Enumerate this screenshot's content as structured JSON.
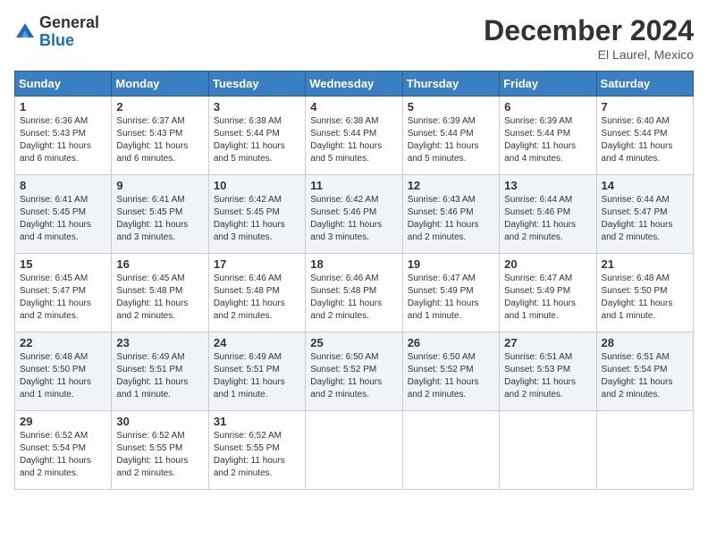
{
  "logo": {
    "general": "General",
    "blue": "Blue"
  },
  "title": "December 2024",
  "subtitle": "El Laurel, Mexico",
  "weekdays": [
    "Sunday",
    "Monday",
    "Tuesday",
    "Wednesday",
    "Thursday",
    "Friday",
    "Saturday"
  ],
  "weeks": [
    [
      {
        "day": "1",
        "sunrise": "6:36 AM",
        "sunset": "5:43 PM",
        "daylight": "11 hours and 6 minutes."
      },
      {
        "day": "2",
        "sunrise": "6:37 AM",
        "sunset": "5:43 PM",
        "daylight": "11 hours and 6 minutes."
      },
      {
        "day": "3",
        "sunrise": "6:38 AM",
        "sunset": "5:44 PM",
        "daylight": "11 hours and 5 minutes."
      },
      {
        "day": "4",
        "sunrise": "6:38 AM",
        "sunset": "5:44 PM",
        "daylight": "11 hours and 5 minutes."
      },
      {
        "day": "5",
        "sunrise": "6:39 AM",
        "sunset": "5:44 PM",
        "daylight": "11 hours and 5 minutes."
      },
      {
        "day": "6",
        "sunrise": "6:39 AM",
        "sunset": "5:44 PM",
        "daylight": "11 hours and 4 minutes."
      },
      {
        "day": "7",
        "sunrise": "6:40 AM",
        "sunset": "5:44 PM",
        "daylight": "11 hours and 4 minutes."
      }
    ],
    [
      {
        "day": "8",
        "sunrise": "6:41 AM",
        "sunset": "5:45 PM",
        "daylight": "11 hours and 4 minutes."
      },
      {
        "day": "9",
        "sunrise": "6:41 AM",
        "sunset": "5:45 PM",
        "daylight": "11 hours and 3 minutes."
      },
      {
        "day": "10",
        "sunrise": "6:42 AM",
        "sunset": "5:45 PM",
        "daylight": "11 hours and 3 minutes."
      },
      {
        "day": "11",
        "sunrise": "6:42 AM",
        "sunset": "5:46 PM",
        "daylight": "11 hours and 3 minutes."
      },
      {
        "day": "12",
        "sunrise": "6:43 AM",
        "sunset": "5:46 PM",
        "daylight": "11 hours and 2 minutes."
      },
      {
        "day": "13",
        "sunrise": "6:44 AM",
        "sunset": "5:46 PM",
        "daylight": "11 hours and 2 minutes."
      },
      {
        "day": "14",
        "sunrise": "6:44 AM",
        "sunset": "5:47 PM",
        "daylight": "11 hours and 2 minutes."
      }
    ],
    [
      {
        "day": "15",
        "sunrise": "6:45 AM",
        "sunset": "5:47 PM",
        "daylight": "11 hours and 2 minutes."
      },
      {
        "day": "16",
        "sunrise": "6:45 AM",
        "sunset": "5:48 PM",
        "daylight": "11 hours and 2 minutes."
      },
      {
        "day": "17",
        "sunrise": "6:46 AM",
        "sunset": "5:48 PM",
        "daylight": "11 hours and 2 minutes."
      },
      {
        "day": "18",
        "sunrise": "6:46 AM",
        "sunset": "5:48 PM",
        "daylight": "11 hours and 2 minutes."
      },
      {
        "day": "19",
        "sunrise": "6:47 AM",
        "sunset": "5:49 PM",
        "daylight": "11 hours and 1 minute."
      },
      {
        "day": "20",
        "sunrise": "6:47 AM",
        "sunset": "5:49 PM",
        "daylight": "11 hours and 1 minute."
      },
      {
        "day": "21",
        "sunrise": "6:48 AM",
        "sunset": "5:50 PM",
        "daylight": "11 hours and 1 minute."
      }
    ],
    [
      {
        "day": "22",
        "sunrise": "6:48 AM",
        "sunset": "5:50 PM",
        "daylight": "11 hours and 1 minute."
      },
      {
        "day": "23",
        "sunrise": "6:49 AM",
        "sunset": "5:51 PM",
        "daylight": "11 hours and 1 minute."
      },
      {
        "day": "24",
        "sunrise": "6:49 AM",
        "sunset": "5:51 PM",
        "daylight": "11 hours and 1 minute."
      },
      {
        "day": "25",
        "sunrise": "6:50 AM",
        "sunset": "5:52 PM",
        "daylight": "11 hours and 2 minutes."
      },
      {
        "day": "26",
        "sunrise": "6:50 AM",
        "sunset": "5:52 PM",
        "daylight": "11 hours and 2 minutes."
      },
      {
        "day": "27",
        "sunrise": "6:51 AM",
        "sunset": "5:53 PM",
        "daylight": "11 hours and 2 minutes."
      },
      {
        "day": "28",
        "sunrise": "6:51 AM",
        "sunset": "5:54 PM",
        "daylight": "11 hours and 2 minutes."
      }
    ],
    [
      {
        "day": "29",
        "sunrise": "6:52 AM",
        "sunset": "5:54 PM",
        "daylight": "11 hours and 2 minutes."
      },
      {
        "day": "30",
        "sunrise": "6:52 AM",
        "sunset": "5:55 PM",
        "daylight": "11 hours and 2 minutes."
      },
      {
        "day": "31",
        "sunrise": "6:52 AM",
        "sunset": "5:55 PM",
        "daylight": "11 hours and 2 minutes."
      },
      null,
      null,
      null,
      null
    ]
  ],
  "labels": {
    "sunrise": "Sunrise:",
    "sunset": "Sunset:",
    "daylight": "Daylight hours"
  }
}
